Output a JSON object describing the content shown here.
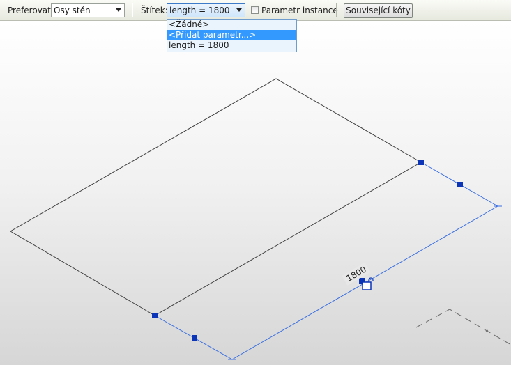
{
  "optionsbar": {
    "prefer_label": "Preferovat:",
    "prefer_value": "Osy stěn",
    "tag_label": "Štítek:",
    "tag_value": "length = 1800",
    "instance_label": "Parametr instance",
    "related_button": "Související kóty"
  },
  "dropdown": {
    "items": [
      "<Žádné>",
      "<Přidat parametr...>",
      "length = 1800"
    ],
    "selected_index": 1
  },
  "canvas": {
    "dimension_text": "1800",
    "element_color": "#3f3f3f",
    "dimension_color": "#3b6fe0",
    "grip_color": "#0b34b6"
  }
}
